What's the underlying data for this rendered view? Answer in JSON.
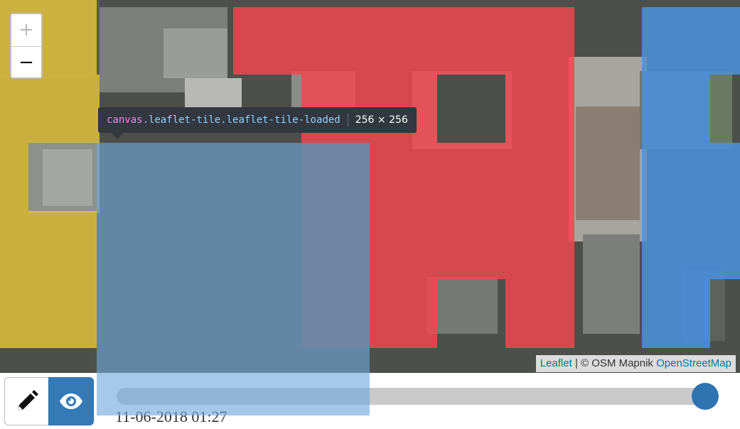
{
  "map": {
    "zoom_in_label": "+",
    "zoom_out_label": "−",
    "overlay_colors": {
      "yellow": "#e4c43a",
      "red": "#f0474f",
      "blue": "#4a90e2",
      "highlight": "#6fa8dc"
    }
  },
  "inspector_tooltip": {
    "tag": "canvas",
    "classes": ".leaflet-tile.leaflet-tile-loaded",
    "dimensions": "256 × 256"
  },
  "attribution": {
    "leaflet": "Leaflet",
    "separator": " | © OSM Mapnik ",
    "osm": "OpenStreetMap"
  },
  "controls": {
    "edit_icon": "pencil-icon",
    "view_icon": "eye-icon",
    "accent": "#337ab7"
  },
  "timeline": {
    "date": "11-06-2018 01:27",
    "position": 1.0
  }
}
